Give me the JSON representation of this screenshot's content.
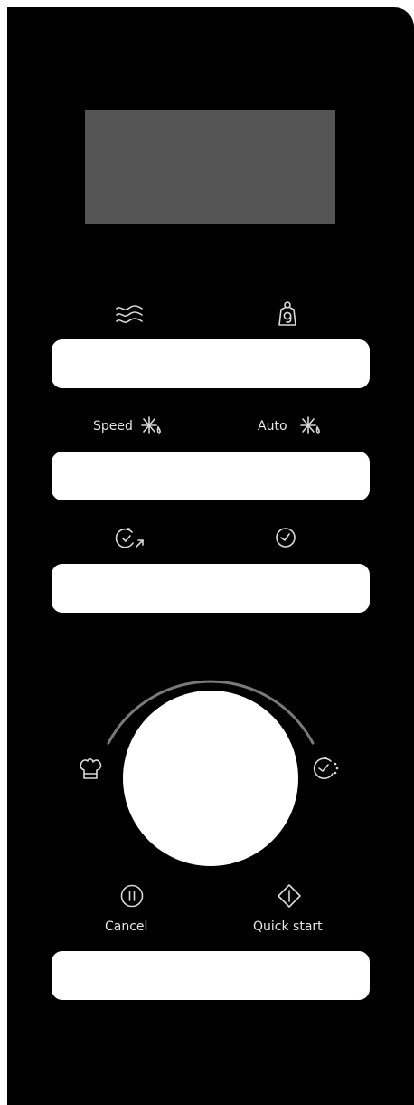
{
  "panel": {
    "background": "#000000",
    "display_color": "#555555"
  },
  "row1": {
    "left_icon": "microwave-waves-icon",
    "right_icon": "weight-defrost-icon"
  },
  "row2": {
    "left_label": "Speed",
    "left_icon": "speed-defrost-icon",
    "right_label": "Auto",
    "right_icon": "auto-defrost-icon"
  },
  "row3": {
    "left_icon": "timer-add-icon",
    "right_icon": "clock-icon"
  },
  "dial": {
    "left_icon": "chef-hat-icon",
    "right_icon": "timer-dotted-icon"
  },
  "bottom": {
    "cancel_label": "Cancel",
    "cancel_icon": "pause-cancel-icon",
    "quick_start_label": "Quick start",
    "quick_start_icon": "diamond-start-icon"
  }
}
